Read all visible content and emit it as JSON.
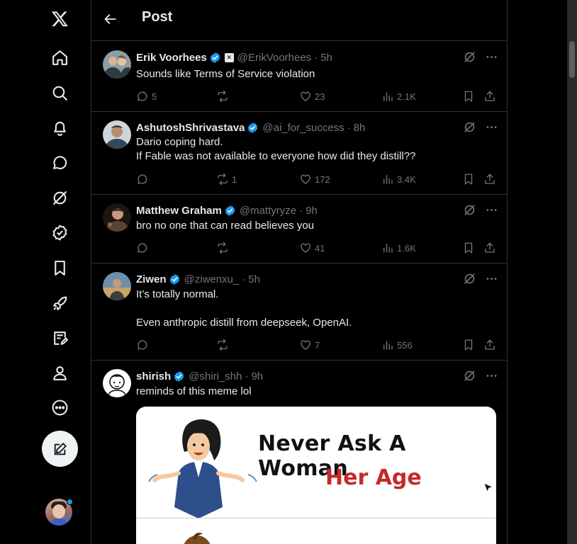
{
  "header": {
    "title": "Post"
  },
  "nav": {
    "items": [
      "x-logo",
      "home",
      "explore",
      "notifications",
      "messages",
      "grok",
      "verified",
      "bookmarks",
      "premium",
      "lists",
      "profile",
      "more"
    ]
  },
  "tweets": [
    {
      "name": "Erik Voorhees",
      "handle": "@ErikVoorhees",
      "time": "5h",
      "text": "Sounds like Terms of Service violation",
      "replies": "5",
      "retweets": "",
      "likes": "23",
      "views": "2.1K"
    },
    {
      "name": "AshutoshShrivastava",
      "handle": "@ai_for_success",
      "time": "8h",
      "text": "Dario coping hard.\nIf Fable was not available to everyone how did they distill??",
      "replies": "",
      "retweets": "1",
      "likes": "172",
      "views": "3.4K"
    },
    {
      "name": "Matthew Graham",
      "handle": "@mattyryze",
      "time": "9h",
      "text": "bro no one that can read believes you",
      "replies": "",
      "retweets": "",
      "likes": "41",
      "views": "1.6K"
    },
    {
      "name": "Ziwen",
      "handle": "@ziwenxu_",
      "time": "5h",
      "text": "It’s totally normal.\n\nEven anthropic distill from deepseek, OpenAI.",
      "replies": "",
      "retweets": "",
      "likes": "7",
      "views": "556"
    },
    {
      "name": "shirish",
      "handle": "@shiri_shh",
      "time": "9h",
      "text": "reminds of this meme lol",
      "meme": {
        "line1": "Never Ask A Woman",
        "line2": "Her Age"
      }
    }
  ],
  "colors": {
    "accent": "#1d9bf0",
    "muted": "#71767b",
    "text": "#e7e9ea",
    "border": "#2f3336",
    "meme_red": "#c62828"
  }
}
